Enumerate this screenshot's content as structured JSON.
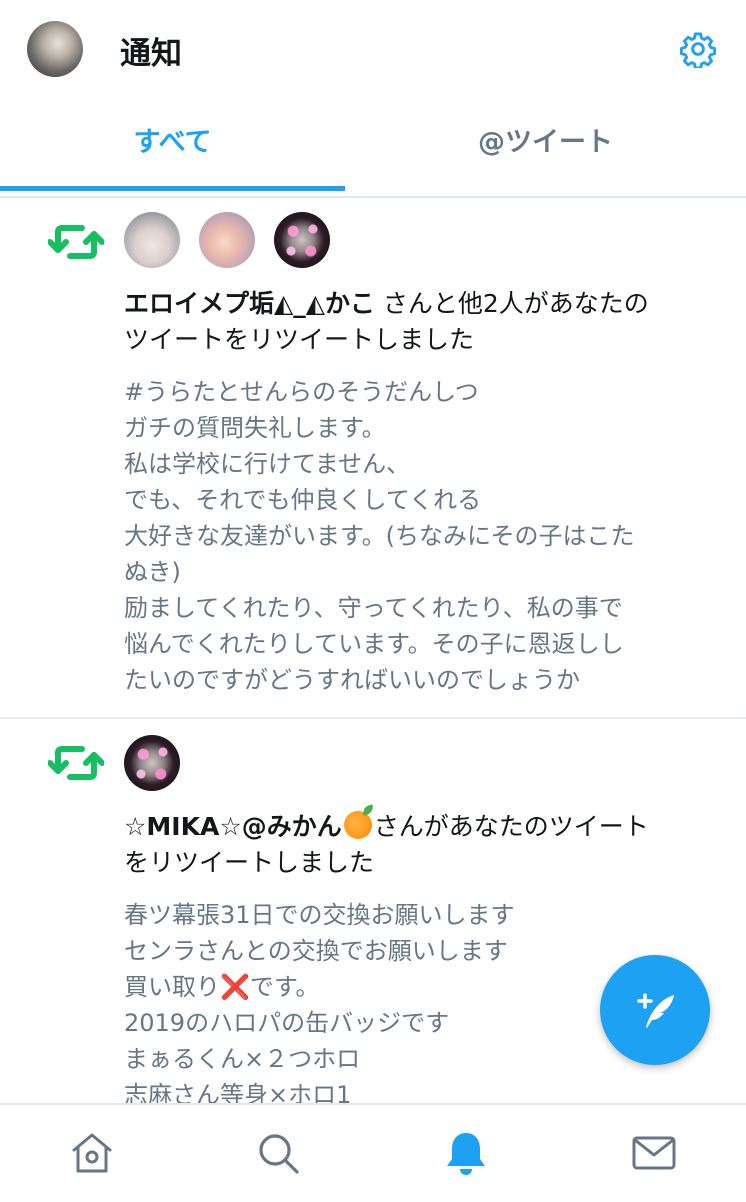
{
  "header": {
    "title": "通知",
    "avatar_icon": "user-avatar",
    "settings_icon": "gear-icon"
  },
  "tabs": [
    {
      "label": "すべて",
      "active": true
    },
    {
      "label": "@ツイート",
      "active": false
    }
  ],
  "notifications": [
    {
      "type": "retweet",
      "icon": "retweet-icon",
      "actor_name": "エロイメプ垢◭_◭かこ",
      "action_text": " さんと他2人があなたの",
      "action_text_2": "ツイートをリツイートしました",
      "tweet_lines": [
        "#うらたとせんらのそうだんしつ",
        "ガチの質問失礼します。",
        "私は学校に行けてません、",
        "でも、それでも仲良くしてくれる",
        "大好きな友達がいます。(ちなみにその子はこた",
        "ぬき)",
        "励ましてくれたり、守ってくれたり、私の事で",
        "悩んでくれたりしています。その子に恩返しし",
        "たいのですがどうすればいいのでしょうか"
      ]
    },
    {
      "type": "retweet",
      "icon": "retweet-icon",
      "actor_name": "☆MIKA☆@みかん",
      "actor_emoji": "orange-emoji",
      "action_text": "さんがあなたのツイート",
      "action_text_2": "をリツイートしました",
      "tweet_lines": [
        "春ツ幕張31日での交換お願いします",
        "センラさんとの交換でお願いします",
        "買い取り",
        "です。",
        "2019のハロパの缶バッジです",
        "まぁるくん×２つホロ",
        "志麻さん等身×ホロ1"
      ],
      "cross_mark": "❌"
    }
  ],
  "fab": {
    "icon": "compose-tweet-icon"
  },
  "bottom_nav": [
    {
      "icon": "home-icon",
      "active": false
    },
    {
      "icon": "search-icon",
      "active": false
    },
    {
      "icon": "bell-icon",
      "active": true
    },
    {
      "icon": "mail-icon",
      "active": false
    }
  ],
  "colors": {
    "accent": "#1da1f2",
    "retweet_green": "#17bf63",
    "secondary_text": "#657786",
    "inactive_icon": "#657786"
  }
}
